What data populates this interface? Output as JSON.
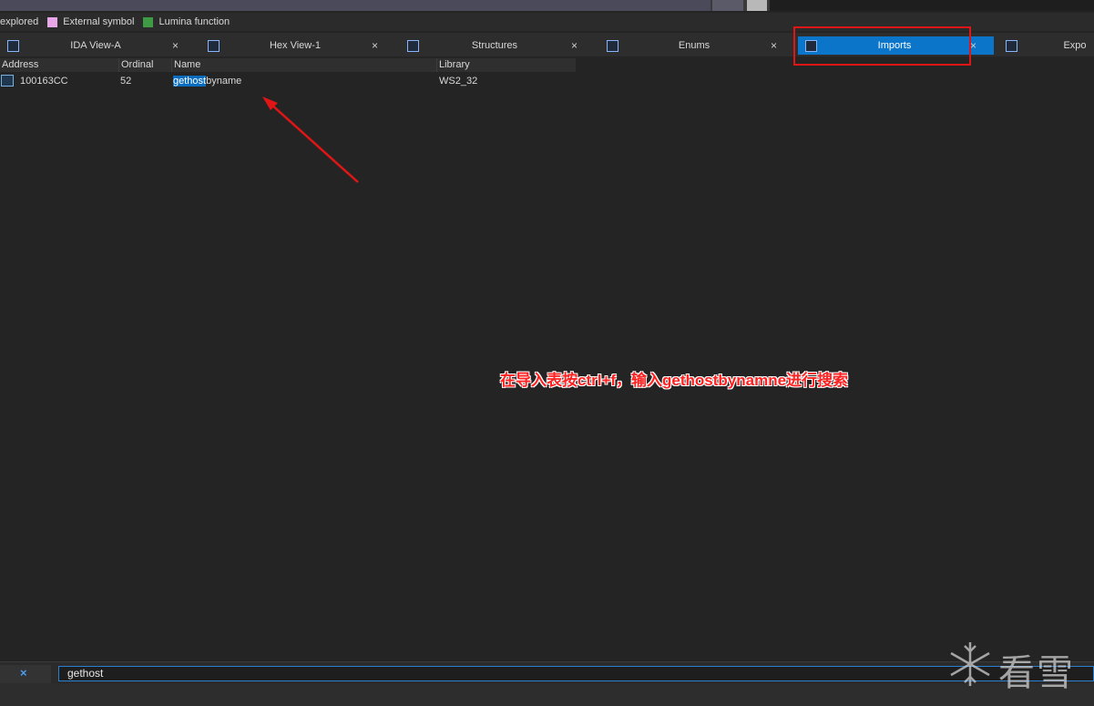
{
  "legend": {
    "items": [
      {
        "label": "explored",
        "color": ""
      },
      {
        "label": "External symbol",
        "color": "#e7a7e7"
      },
      {
        "label": "Lumina function",
        "color": "#3f9a45"
      }
    ]
  },
  "tabs": [
    {
      "label": "IDA View-A",
      "icon": "ida-view-icon",
      "active": false
    },
    {
      "label": "Hex View-1",
      "icon": "hex-view-icon",
      "active": false
    },
    {
      "label": "Structures",
      "icon": "structures-icon",
      "active": false
    },
    {
      "label": "Enums",
      "icon": "enums-icon",
      "active": false
    },
    {
      "label": "Imports",
      "icon": "imports-icon",
      "active": true
    },
    {
      "label": "Expo",
      "icon": "exports-icon",
      "active": false
    }
  ],
  "close_glyph": "×",
  "table": {
    "columns": [
      "Address",
      "Ordinal",
      "Name",
      "Library"
    ],
    "rows": [
      {
        "address": "100163CC",
        "ordinal": "52",
        "name_match": "gethost",
        "name_rest": "byname",
        "library": "WS2_32"
      }
    ]
  },
  "annotation": "在导入表按ctrl+f，输入gethostbynamne进行搜索",
  "search": {
    "close_glyph": "×",
    "value": "gethost"
  },
  "watermark": "看雪",
  "colors": {
    "accent": "#0a75c9",
    "highlight_box": "#e01515",
    "annotation": "#ff2020"
  }
}
